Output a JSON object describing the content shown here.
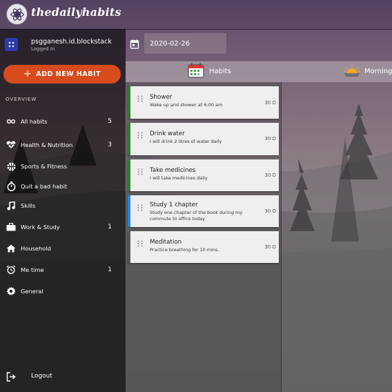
{
  "app": {
    "brand": "thedailyhabits"
  },
  "user": {
    "name": "psgganesh.id.blockstack",
    "status": "Logged In"
  },
  "add_button": {
    "label": "ADD NEW HABIT"
  },
  "date": {
    "value": "2020-02-26"
  },
  "sidebar": {
    "section_title": "OVERVIEW",
    "items": [
      {
        "label": "All habits",
        "count": "5",
        "icon": "infinity-icon"
      },
      {
        "label": "Health & Nutrition",
        "count": "3",
        "icon": "heartbeat-icon"
      },
      {
        "label": "Sports & Fitness",
        "count": "",
        "icon": "basketball-icon"
      },
      {
        "label": "Quit a bad habit",
        "count": "",
        "icon": "timer-icon"
      },
      {
        "label": "Skills",
        "count": "",
        "icon": "music-note-icon"
      },
      {
        "label": "Work & Study",
        "count": "1",
        "icon": "briefcase-icon"
      },
      {
        "label": "Household",
        "count": "",
        "icon": "home-icon"
      },
      {
        "label": "Me time",
        "count": "1",
        "icon": "alarm-clock-icon"
      },
      {
        "label": "General",
        "count": "",
        "icon": "gear-icon"
      }
    ],
    "logout": "Logout"
  },
  "tabs": [
    {
      "label": "Habits",
      "icon": "calendar-icon"
    },
    {
      "label": "Morning",
      "icon": "sunrise-icon"
    }
  ],
  "habits": [
    {
      "title": "Shower",
      "description": "Wake up and shower at 6:00 am",
      "duration": "30 D",
      "color": "#2e7d32"
    },
    {
      "title": "Drink water",
      "description": "I will drink 2 litres of water daily",
      "duration": "30 D",
      "color": "#2e7d32"
    },
    {
      "title": "Take medicines",
      "description": "I will take medicines daily",
      "duration": "30 D",
      "color": "#2e7d32"
    },
    {
      "title": "Study 1 chapter",
      "description": "Study one chapter of the book during my commute to office today",
      "duration": "30 D",
      "color": "#1e88e5"
    },
    {
      "title": "Meditation",
      "description": "Practice breathing for 10 mins.",
      "duration": "30 D",
      "color": "#555555"
    }
  ],
  "colors": {
    "accent": "#d84b1c",
    "avatar": "#2d3bb0"
  }
}
